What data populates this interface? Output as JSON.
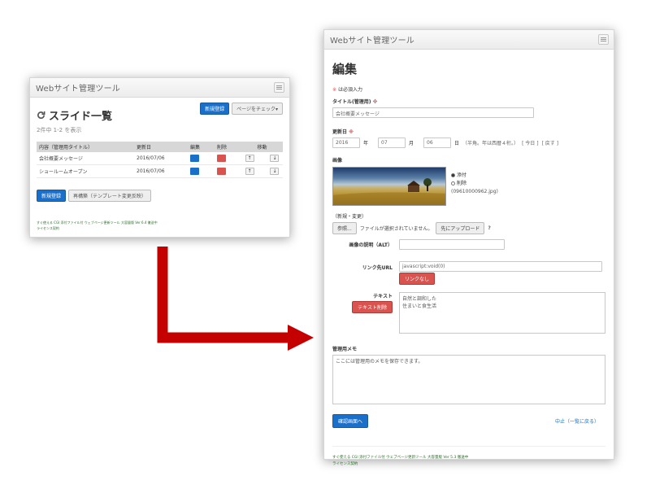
{
  "list_window": {
    "title": "Webサイト管理ツール",
    "heading": "スライド一覧",
    "count": "2件中 1-2 を表示",
    "new_button": "新規登録",
    "check_button": "ページをチェック▾",
    "columns": [
      "内容（管理用タイトル）",
      "更新日",
      "編集",
      "削除",
      "移動"
    ],
    "rows": [
      {
        "title": "会社概要メッセージ",
        "date": "2016/07/06"
      },
      {
        "title": "ショールームオープン",
        "date": "2016/07/06"
      }
    ],
    "bottom_new_button": "新規登録",
    "rebuild_button": "再構築（テンプレート変更反映）",
    "footer_line1": "すぐ使える CGI 添付ファイル付 ウェブページ更新ツール 大容量版 Ver 6.4 徹送中",
    "footer_line2": "ライセンス契約"
  },
  "edit_window": {
    "title": "Webサイト管理ツール",
    "heading": "編集",
    "required_note_mark": "※",
    "required_note": "は必須入力",
    "title_label": "タイトル(管理用)",
    "title_req": "※",
    "title_value": "会社概要メッセージ",
    "date_label": "更新日",
    "date_req": "※",
    "year": "2016",
    "year_unit": "年",
    "month": "07",
    "month_unit": "月",
    "day": "06",
    "day_unit": "日",
    "date_hint": "（半角。年は西暦４桁。）",
    "today_link": "[ 今日 ]",
    "reset_link": "[ 戻す ]",
    "image_label": "画像",
    "radio_keep": "添付",
    "radio_delete": "削除",
    "image_file": "(09610000962.jpg)",
    "new_change_label": "（新規・変更）",
    "browse_button": "参照...",
    "no_file_text": "ファイルが選択されていません。",
    "upload_button": "先にアップロード",
    "help_icon": "?",
    "alt_label": "画像の説明（ALT）",
    "alt_value": "",
    "link_label": "リンク先URL",
    "link_value": "javascript:void(0)",
    "no_link_button": "リンクなし",
    "text_label": "テキスト",
    "text_delete_button": "テキスト削除",
    "text_value_line1": "自然と調和した",
    "text_value_line2": "住まいと食生活",
    "memo_label": "管理用メモ",
    "memo_value": "ここには管理用のメモを保存できます。",
    "confirm_button": "確認画面へ",
    "cancel_link": "中止（一覧に戻る）",
    "footer_line1": "すぐ使える CGI 添付ファイル付 ウェブページ更新ツール 大容量版 Ver 5.3 徹送中",
    "footer_line2": "ライセンス契約"
  },
  "colors": {
    "primary": "#1a6fc9",
    "danger": "#d9534f",
    "arrow": "#c40000"
  }
}
